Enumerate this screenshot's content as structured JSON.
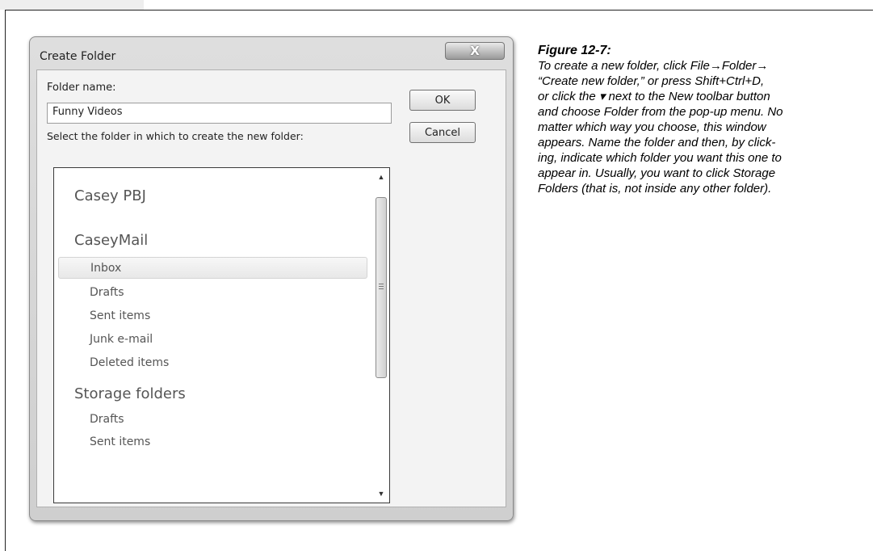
{
  "dialog": {
    "title": "Create Folder",
    "close_glyph": "X",
    "folder_name_label": "Folder name:",
    "folder_name_value": "Funny Videos",
    "select_label": "Select the folder in which to create the new folder:",
    "ok_label": "OK",
    "cancel_label": "Cancel",
    "tree": {
      "accounts": [
        {
          "label": "Casey PBJ",
          "folders": []
        },
        {
          "label": "CaseyMail",
          "folders": [
            "Inbox",
            "Drafts",
            "Sent items",
            "Junk e-mail",
            "Deleted items"
          ]
        },
        {
          "label": "Storage folders",
          "folders": [
            "Drafts",
            "Sent items"
          ]
        }
      ],
      "selected": "Inbox"
    }
  },
  "caption": {
    "title": "Figure 12-7:",
    "lines": [
      "To create a new folder, click File→Folder→",
      "“Create new folder,” or press Shift+Ctrl+D,",
      "or click the ▾ next to the New toolbar button",
      "and choose Folder from the pop-up menu. No",
      "matter which way you choose, this window",
      "appears. Name the folder and then, by click-",
      "ing, indicate which folder you want this one to",
      "appear in. Usually, you want to click Storage",
      "Folders (that is, not inside any other folder)."
    ]
  },
  "icons": {
    "scroll_up": "▲",
    "scroll_down": "▼"
  }
}
